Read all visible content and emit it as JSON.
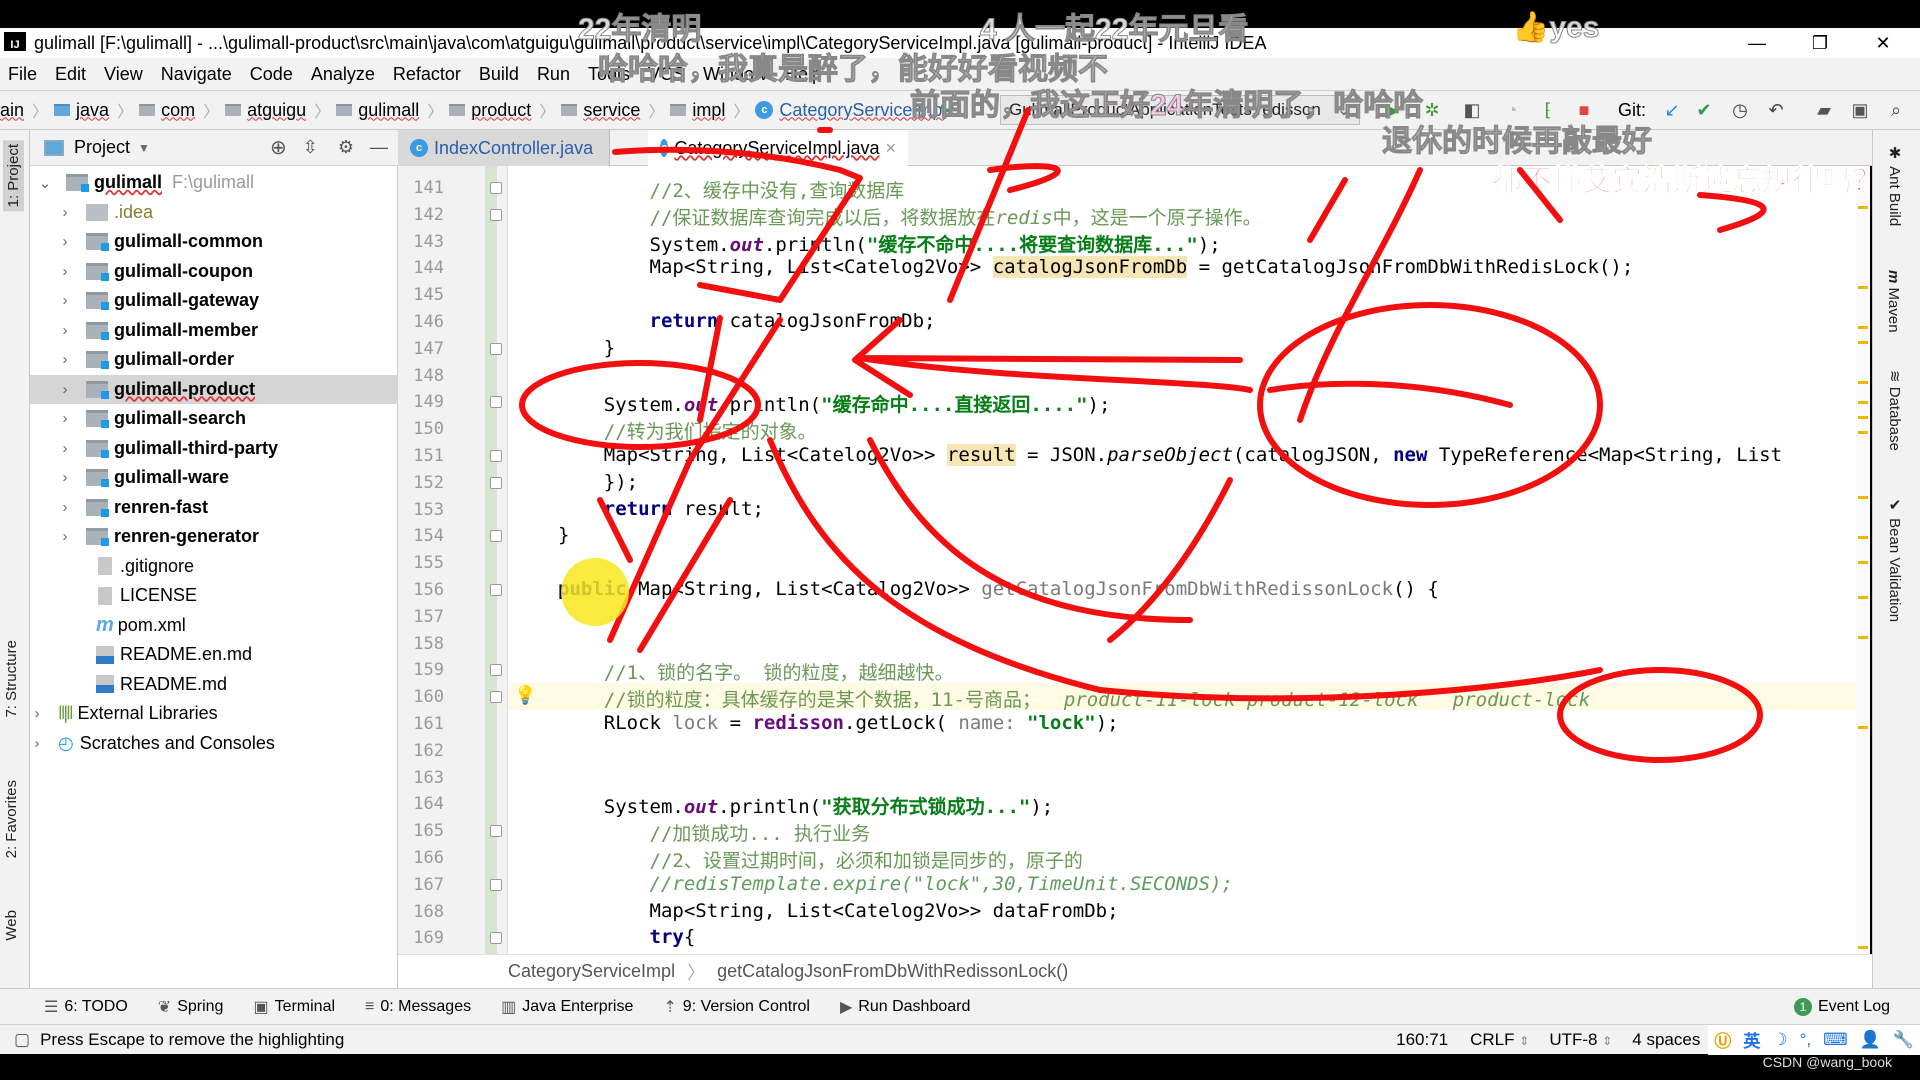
{
  "window": {
    "title": "gulimall [F:\\gulimall] - ...\\gulimall-product\\src\\main\\java\\com\\atguigu\\gulimall\\product\\service\\impl\\CategoryServiceImpl.java [gulimall-product] - IntelliJ IDEA",
    "logo": "IJ",
    "minimize": "—",
    "restore": "❐",
    "close": "✕"
  },
  "menu": [
    "File",
    "Edit",
    "View",
    "Navigate",
    "Code",
    "Analyze",
    "Refactor",
    "Build",
    "Run",
    "Tools",
    "VCS",
    "Window",
    "Help"
  ],
  "nav": {
    "crumbs": [
      "ain",
      "java",
      "com",
      "atguigu",
      "gulimall",
      "product",
      "service",
      "impl"
    ],
    "file": "CategoryServiceImpl",
    "run_config": "GulimallProductApplicationTests.redisson",
    "git_label": "Git:"
  },
  "project": {
    "header": "Project",
    "root": {
      "name": "gulimall",
      "path": "F:\\gulimall"
    },
    "items": [
      {
        "name": ".idea",
        "type": "folder"
      },
      {
        "name": "gulimall-common",
        "type": "module"
      },
      {
        "name": "gulimall-coupon",
        "type": "module"
      },
      {
        "name": "gulimall-gateway",
        "type": "module"
      },
      {
        "name": "gulimall-member",
        "type": "module"
      },
      {
        "name": "gulimall-order",
        "type": "module"
      },
      {
        "name": "gulimall-product",
        "type": "module",
        "selected": true
      },
      {
        "name": "gulimall-search",
        "type": "module"
      },
      {
        "name": "gulimall-third-party",
        "type": "module"
      },
      {
        "name": "gulimall-ware",
        "type": "module"
      },
      {
        "name": "renren-fast",
        "type": "module"
      },
      {
        "name": "renren-generator",
        "type": "module"
      },
      {
        "name": ".gitignore",
        "type": "file"
      },
      {
        "name": "LICENSE",
        "type": "file"
      },
      {
        "name": "pom.xml",
        "type": "maven"
      },
      {
        "name": "README.en.md",
        "type": "md"
      },
      {
        "name": "README.md",
        "type": "md"
      },
      {
        "name": "External Libraries",
        "type": "libs"
      },
      {
        "name": "Scratches and Consoles",
        "type": "scratch"
      }
    ]
  },
  "left_tabs": [
    "1: Project",
    "7: Structure",
    "2: Favorites",
    "Web"
  ],
  "right_tabs": [
    "Ant Build",
    "Maven",
    "Database",
    "Bean Validation"
  ],
  "tabs": [
    {
      "label": "IndexController.java",
      "active": false
    },
    {
      "label": "CategoryServiceImpl.java",
      "active": true
    }
  ],
  "editor": {
    "current_line": 160,
    "lines": [
      {
        "n": 141,
        "html": "        <span class='cm'>//2、缓存中没有,查询数据库</span>"
      },
      {
        "n": 142,
        "html": "        <span class='cm'>//保证数据库查询完成以后，将数据放在<i>redis</i>中，这是一个原子操作。</span>"
      },
      {
        "n": 143,
        "html": "        System.<span class='fld'>out</span>.println(<span class='st'>\"缓存不命中....将要查询数据库...\"</span>);"
      },
      {
        "n": 144,
        "html": "        Map&lt;String, List&lt;Catelog2Vo&gt;&gt; <span class='hl'>catalogJsonFromDb</span> = getCatalogJsonFromDbWithRedisLock();"
      },
      {
        "n": 145,
        "html": ""
      },
      {
        "n": 146,
        "html": "        <span class='kw'>return</span> catalogJsonFromDb;"
      },
      {
        "n": 147,
        "html": "    }"
      },
      {
        "n": 148,
        "html": ""
      },
      {
        "n": 149,
        "html": "    System.<span class='fld'>out</span>.println(<span class='st'>\"缓存命中....直接返回....\"</span>);"
      },
      {
        "n": 150,
        "html": "    <span class='cm'>//转为我们指定的对象。</span>"
      },
      {
        "n": 151,
        "html": "    Map&lt;String, List&lt;Catelog2Vo&gt;&gt; <span class='hl'>result</span> = JSON.<i>parseObject</i>(catalogJSON, <span class='kw'>new</span> TypeReference&lt;Map&lt;String, List"
      },
      {
        "n": 152,
        "html": "    });"
      },
      {
        "n": 153,
        "html": "    <span class='kw'>return</span> result;"
      },
      {
        "n": 154,
        "html": "}"
      },
      {
        "n": 155,
        "html": ""
      },
      {
        "n": 156,
        "html": "<span class='kw'>public</span> Map&lt;String, List&lt;Catalog2Vo&gt;&gt; <span class='gr'>getCatalogJsonFromDbWithRedissonLock</span>() {"
      },
      {
        "n": 157,
        "html": ""
      },
      {
        "n": 158,
        "html": ""
      },
      {
        "n": 159,
        "html": "    <span class='cm'>//1、锁的名字。 锁的粒度，越细越快。</span>"
      },
      {
        "n": 160,
        "html": "    <span class='cm'>//锁的粒度：具体缓存的是某个数据，11-号商品；  <i>product-11-lock product-12-lock   product-lock</i></span>"
      },
      {
        "n": 161,
        "html": "    RLock <span class='gr'>lock</span> = <span class='fld' style='font-style:normal'>redisson</span>.getLock( <span class='gr'>name:</span> <span class='st'>\"lock\"</span>);"
      },
      {
        "n": 162,
        "html": ""
      },
      {
        "n": 163,
        "html": ""
      },
      {
        "n": 164,
        "html": "    System.<span class='fld'>out</span>.println(<span class='st'>\"获取分布式锁成功...\"</span>);"
      },
      {
        "n": 165,
        "html": "        <span class='cm'>//加锁成功... 执行业务</span>"
      },
      {
        "n": 166,
        "html": "        <span class='cm'>//2、设置过期时间，必须和加锁是同步的，原子的</span>"
      },
      {
        "n": 167,
        "html": "        <span class='cmi'>//redisTemplate.expire(\"lock\",30,TimeUnit.SECONDS);</span>"
      },
      {
        "n": 168,
        "html": "        Map&lt;String, List&lt;Catelog2Vo&gt;&gt; dataFromDb;"
      },
      {
        "n": 169,
        "html": "        <span class='kw'>try</span>{"
      }
    ]
  },
  "editor_breadcrumb": {
    "class": "CategoryServiceImpl",
    "method": "getCatalogJsonFromDbWithRedissonLock()"
  },
  "toolwindows": [
    {
      "icon": "☰",
      "label": "6: TODO"
    },
    {
      "icon": "❦",
      "label": "Spring"
    },
    {
      "icon": "▣",
      "label": "Terminal"
    },
    {
      "icon": "≡",
      "label": "0: Messages"
    },
    {
      "icon": "▥",
      "label": "Java Enterprise"
    },
    {
      "icon": "⇡",
      "label": "9: Version Control"
    },
    {
      "icon": "▶",
      "label": "Run Dashboard"
    }
  ],
  "event_log": {
    "count": "1",
    "label": "Event Log"
  },
  "status": {
    "message": "Press Escape to remove the highlighting",
    "position": "160:71",
    "line_sep": "CRLF",
    "encoding": "UTF-8",
    "indent": "4 spaces",
    "ime": "英"
  },
  "overlay": {
    "danmu": [
      {
        "text": "22年清明",
        "color": "#ffffff"
      },
      {
        "text": "4 人一起22年元旦看",
        "color": "#ffffff"
      },
      {
        "text": "哈哈哈，我真是醉了，能好好看视频不",
        "color": "#ffffff"
      },
      {
        "text": "前面的，我这正好24年清明了，哈哈哈",
        "color": "#f7b6e0"
      },
      {
        "text": "退休的时候再敲最好",
        "color": "#ffffff"
      },
      {
        "text": "都不懂艾宾浩斯遗忘规律吗？",
        "color": "#e23c3c"
      },
      {
        "text": "yes",
        "color": "#ffffff"
      }
    ],
    "watermark": "CSDN @wang_book"
  }
}
